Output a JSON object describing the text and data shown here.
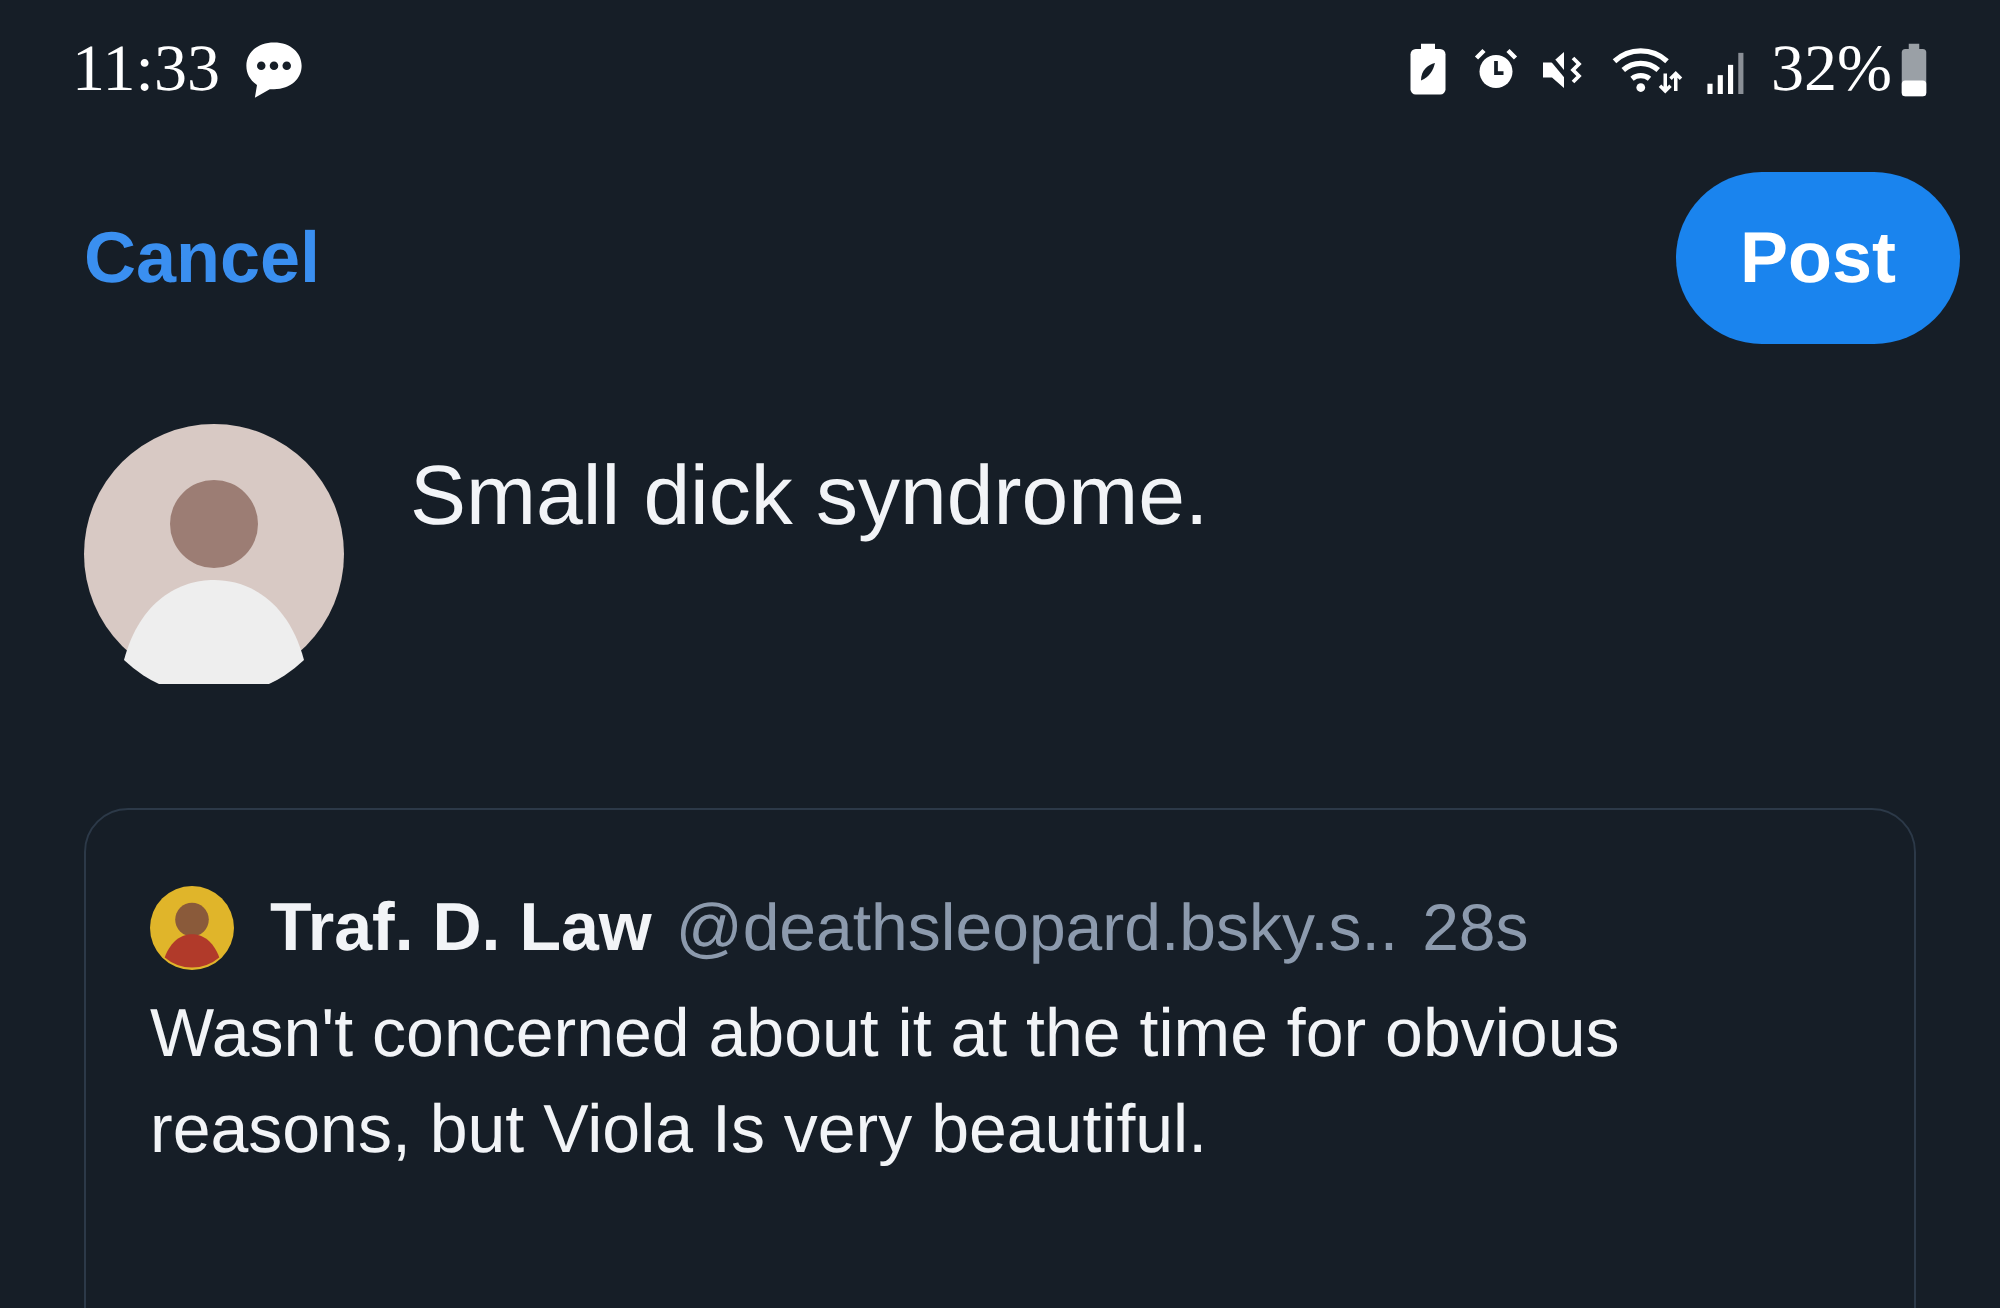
{
  "status_bar": {
    "time": "11:33",
    "battery_percent": "32%"
  },
  "header": {
    "cancel": "Cancel",
    "post": "Post"
  },
  "composer": {
    "text": "Small dick syndrome."
  },
  "quote": {
    "name": "Traf. D. Law",
    "handle": "@deathsleopard.bsky.s..",
    "time": "28s",
    "text": "Wasn't concerned about it at the time for obvious reasons, but Viola Is very beautiful."
  }
}
